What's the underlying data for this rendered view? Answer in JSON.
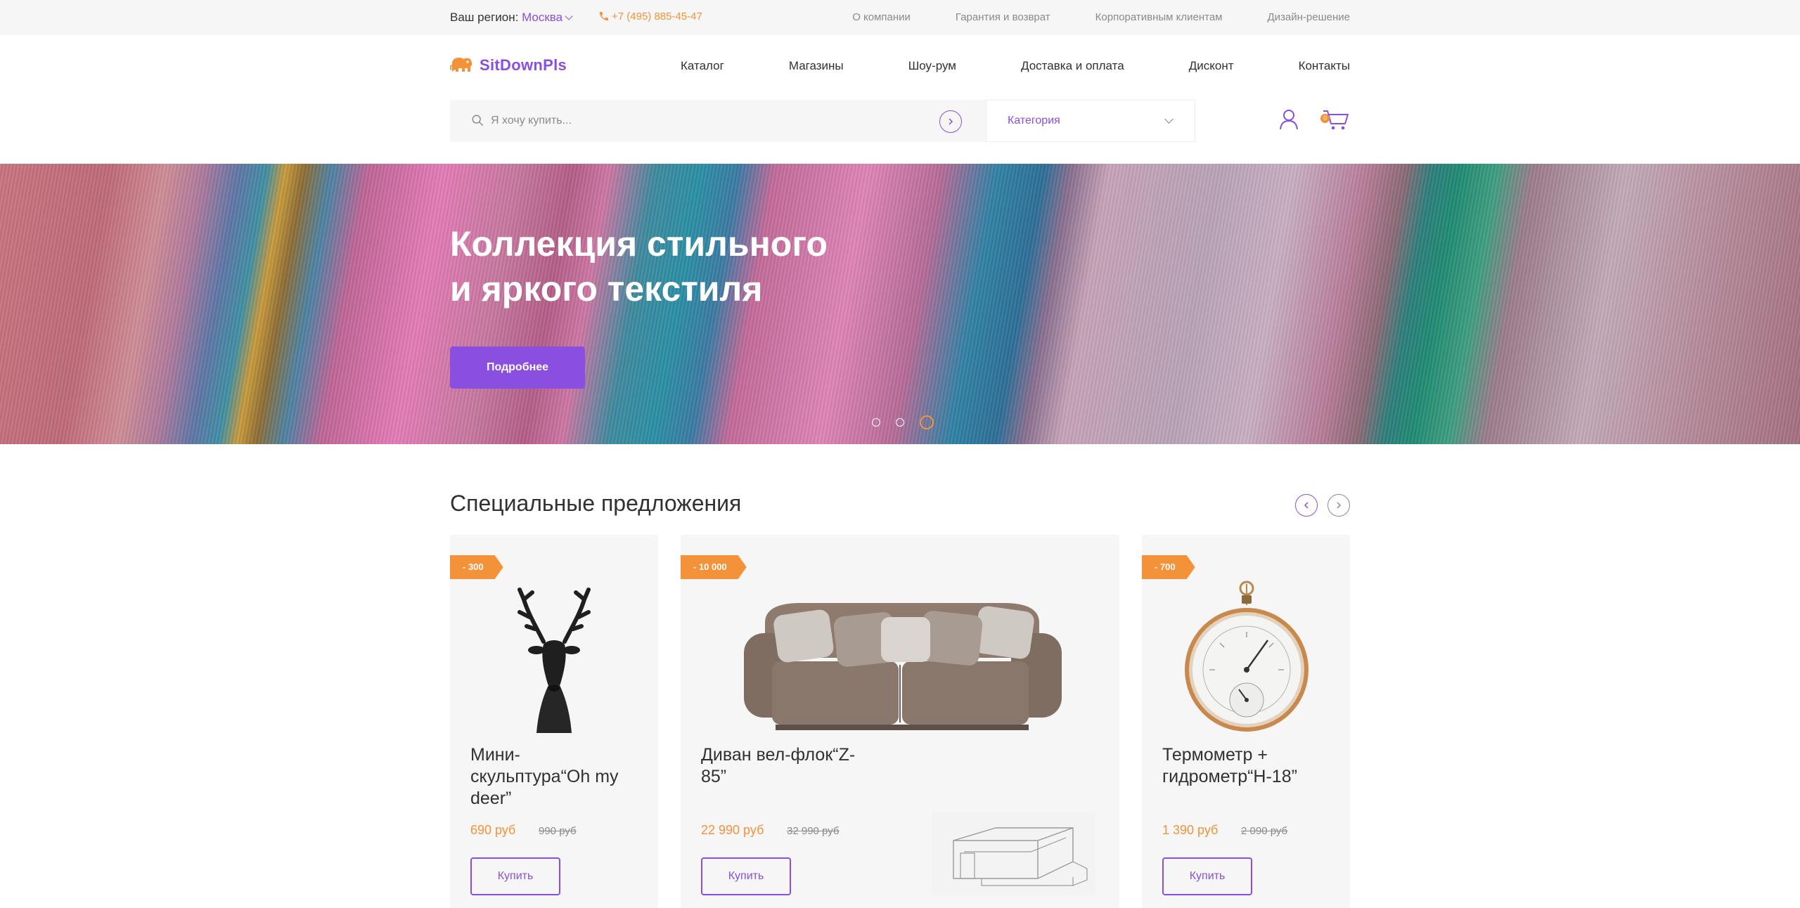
{
  "topbar": {
    "region_label": "Ваш регион:",
    "region_city": "Москва",
    "phone": "+7 (495) 885-45-47",
    "links": [
      "О компании",
      "Гарантия и возврат",
      "Корпоративным клиентам",
      "Дизайн-решение"
    ]
  },
  "header": {
    "logo_text": "SitDownPls",
    "nav": [
      "Каталог",
      "Магазины",
      "Шоу-рум",
      "Доставка и оплата",
      "Дисконт",
      "Контакты"
    ],
    "search_placeholder": "Я хочу купить...",
    "category_label": "Категория",
    "cart_count": "0"
  },
  "hero": {
    "title_line1": "Коллекция стильного",
    "title_line2": "и яркого текстиля",
    "button_label": "Подробнее",
    "slides_total": 3,
    "active_slide": 3
  },
  "offers": {
    "title": "Специальные предложения",
    "items": [
      {
        "discount": "- 300",
        "name_line1": "Мини-",
        "name_line2": "скульптура“Oh my",
        "name_line3": "deer”",
        "price": "690 руб",
        "old_price": "990 руб",
        "buy_label": "Купить"
      },
      {
        "discount": "- 10 000",
        "name_line1": "Диван вел-флок“Z-",
        "name_line2": "85”",
        "price": "22 990 руб",
        "old_price": "32 990 руб",
        "buy_label": "Купить"
      },
      {
        "discount": "- 700",
        "name_line1": "Термометр +",
        "name_line2": "гидрометр“Н-18”",
        "price": "1 390 руб",
        "old_price": "2 090 руб",
        "buy_label": "Купить"
      }
    ]
  },
  "colors": {
    "accent": "#8a4fe0",
    "orange": "#f39239",
    "text": "#313131",
    "muted": "#8a8a8a",
    "bg_light": "#f6f6f6"
  }
}
